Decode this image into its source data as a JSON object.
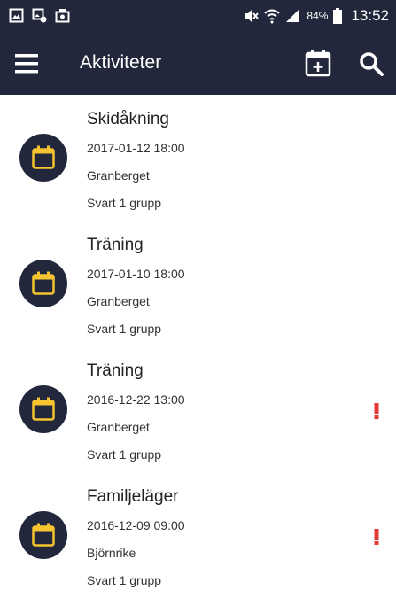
{
  "status_bar": {
    "left_icons": [
      "gallery-icon",
      "image-notification-icon",
      "screenshot-icon"
    ],
    "right_icons": [
      "mute-icon",
      "wifi-icon",
      "signal-icon",
      "battery-icon"
    ],
    "battery_text": "84%",
    "time": "13:52"
  },
  "app_bar": {
    "title": "Aktiviteter",
    "icons": [
      "menu-icon",
      "calendar-add-icon",
      "search-icon"
    ]
  },
  "colors": {
    "bar_background": "#22273c",
    "icon_accent": "#f5c430",
    "alert": "#e53935"
  },
  "activities": [
    {
      "title": "Skidåkning",
      "datetime": "2017-01-12 18:00",
      "place": "Granberget",
      "group": "Svart 1 grupp",
      "alert": false
    },
    {
      "title": "Träning",
      "datetime": "2017-01-10 18:00",
      "place": "Granberget",
      "group": "Svart 1 grupp",
      "alert": false
    },
    {
      "title": "Träning",
      "datetime": "2016-12-22 13:00",
      "place": "Granberget",
      "group": "Svart 1 grupp",
      "alert": true
    },
    {
      "title": "Familjeläger",
      "datetime": "2016-12-09 09:00",
      "place": "Björnrike",
      "group": "Svart 1 grupp",
      "alert": true
    }
  ]
}
